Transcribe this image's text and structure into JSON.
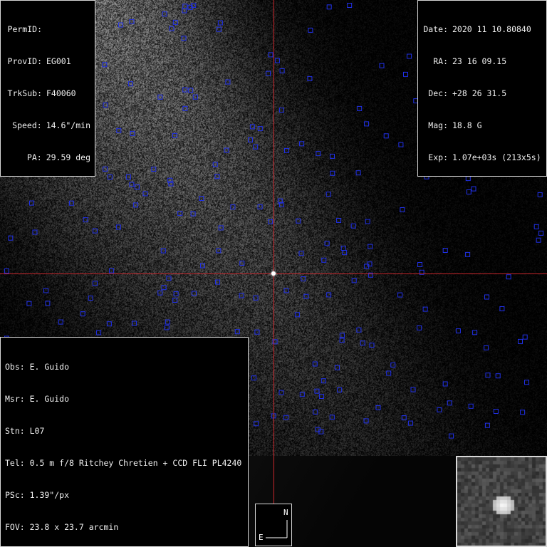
{
  "top_left": {
    "rows": [
      {
        "key": "PermID:",
        "value": ""
      },
      {
        "key": "ProvID:",
        "value": "EG001"
      },
      {
        "key": "TrkSub:",
        "value": "F40060"
      },
      {
        "key": "Speed:",
        "value": "14.6\"/min"
      },
      {
        "key": "PA:",
        "value": "29.59 deg"
      }
    ]
  },
  "top_right": {
    "rows": [
      {
        "key": "Date:",
        "value": "2020 11 10.80840"
      },
      {
        "key": "RA:",
        "value": "23 16 09.15"
      },
      {
        "key": "Dec:",
        "value": "+28 26 31.5"
      },
      {
        "key": "Mag:",
        "value": "18.8 G"
      },
      {
        "key": "Exp:",
        "value": "1.07e+03s (213x5s)"
      }
    ]
  },
  "bottom_left": {
    "lines": [
      "Obs: E. Guido",
      "Msr: E. Guido",
      "Stn: L07",
      "Tel: 0.5 m f/8 Ritchey Chretien + CCD FLI PL4240",
      "PSc: 1.39\"/px",
      "FOV: 23.8 x 23.7 arcmin"
    ]
  },
  "compass": {
    "north": "N",
    "east": "E"
  },
  "colors": {
    "crosshair": "#c8262b",
    "marker": "#2030e8",
    "panel_border": "#d8d8d8"
  }
}
